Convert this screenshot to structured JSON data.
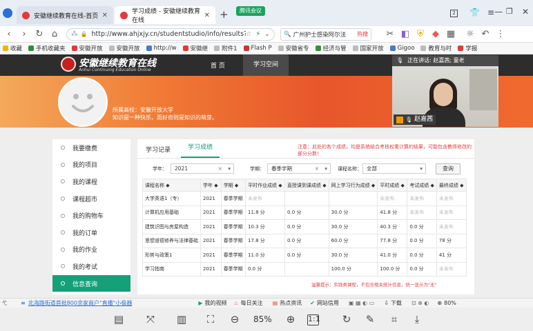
{
  "browser": {
    "tabs": [
      {
        "label": "安徽继续教育在线-首页"
      },
      {
        "label": "学习成绩 - 安徽继续教育在线"
      }
    ],
    "new_tab": "+",
    "meeting_badge": "腾讯会议",
    "tab_count": "2",
    "url": "http://www.ahjxjy.cn/studentstudio/info/results?",
    "search_text": "广州护士感染阿尔法",
    "hot_badge": "热搜"
  },
  "bookmarks": [
    "收藏",
    "手机收藏夹",
    "安徽开放",
    "安徽开放",
    "http://w",
    "安徽继",
    "附件1",
    "Flash P",
    "安徽省专",
    "经济与管",
    "国家开放",
    "Gigoo",
    "教育与时",
    "学报"
  ],
  "site": {
    "logo": "安徽继续教育在线",
    "logo_en": "Anhui Continuing Education Online",
    "nav_home": "首 页",
    "nav_space": "学习空间"
  },
  "banner": {
    "school": "所属高校：安徽开放大学",
    "motto": "知识是一种快乐，而好奇则是知识的萌芽。"
  },
  "video": {
    "speaking": "正在讲话: 赵嘉茜; 童老",
    "name": "赵嘉茜"
  },
  "sidebar": {
    "items": [
      {
        "label": "我要缴费"
      },
      {
        "label": "我的项目"
      },
      {
        "label": "我的课程"
      },
      {
        "label": "课程超市"
      },
      {
        "label": "我的购物车"
      },
      {
        "label": "我的订单"
      },
      {
        "label": "我的作业"
      },
      {
        "label": "我的考试"
      },
      {
        "label": "信息查询"
      }
    ]
  },
  "panel": {
    "tabs": [
      {
        "label": "学习记录"
      },
      {
        "label": "学习成绩"
      }
    ],
    "notice": "注意：此处的各个成绩，均是系统结合考核权重计算的结果，可能包含教师修改的部分分数！",
    "filters": {
      "year_label": "学年：",
      "year_value": "2021",
      "term_label": "学期：",
      "term_value": "春季学期",
      "course_label": "课程名称：",
      "course_value": "全部",
      "query": "查询"
    },
    "table": {
      "headers": [
        "课程名称 ◆",
        "学年 ◆",
        "学期 ◆",
        "平时作业成绩 ◆",
        "直授课到课成绩 ◆",
        "网上学习行为成绩 ◆",
        "平时成绩 ◆",
        "考试成绩 ◆",
        "最终成绩 ◆"
      ],
      "rows": [
        [
          "大学英语1（专）",
          "2021",
          "春季学期",
          "未发布",
          "",
          "",
          "未发布",
          "未发布",
          "未发布"
        ],
        [
          "计算机应用基础",
          "2021",
          "春季学期",
          "11.8 分",
          "0.0 分",
          "30.0 分",
          "41.8 分",
          "未发布",
          "未发布"
        ],
        [
          "建筑识图与房屋构造",
          "2021",
          "春季学期",
          "10.3 分",
          "0.0 分",
          "30.0 分",
          "40.3 分",
          "0.0 分",
          "未发布"
        ],
        [
          "思想道德修养与法律基础",
          "2021",
          "春季学期",
          "17.8 分",
          "0.0 分",
          "60.0 分",
          "77.8 分",
          "0.0 分",
          "78 分"
        ],
        [
          "形势与政策1",
          "2021",
          "春季学期",
          "11.0 分",
          "0.0 分",
          "30.0 分",
          "41.0 分",
          "0.0 分",
          "41 分"
        ],
        [
          "学习指南",
          "2021",
          "春季学期",
          "0.0 分",
          "",
          "100.0 分",
          "100.0 分",
          "0.0 分",
          "未发布"
        ]
      ]
    },
    "footnote": "温馨提示：实践类课程，不包含相关统计信息，统一显示为\"无\""
  },
  "statusbar": {
    "left": "北海路街道首批800余家商户\"直播\"小极器",
    "items": [
      "我的视频",
      "每日关注",
      "热点资讯",
      "网站信用",
      "下载",
      "80%"
    ]
  },
  "pdfbar": {
    "zoom": "85%"
  }
}
